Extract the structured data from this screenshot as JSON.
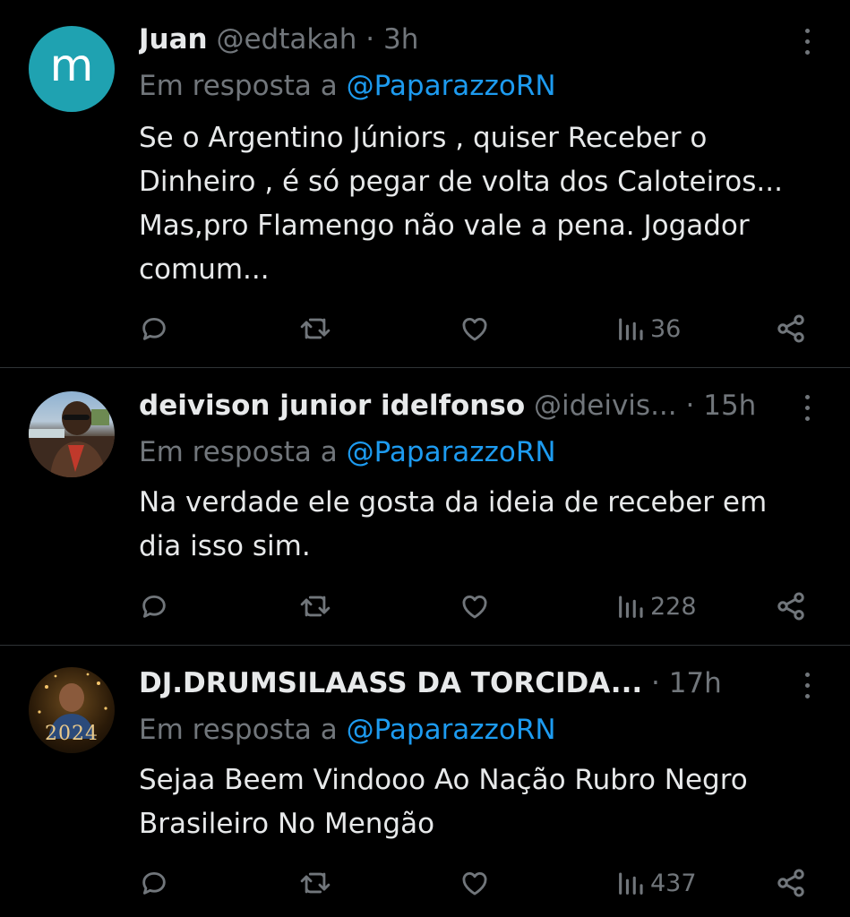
{
  "tweets": [
    {
      "avatar_letter": "m",
      "name": "Juan",
      "handle": "@edtakah",
      "time": "3h",
      "reply_prefix": "Em resposta a",
      "reply_to": "@PaparazzoRN",
      "lines": [
        "Se o Argentino Júniors , quiser Receber o",
        "Dinheiro , é só pegar de volta dos Caloteiros...",
        "Mas,pro Flamengo não vale a pena. Jogador",
        "comum..."
      ],
      "views": "36"
    },
    {
      "name": "deivison junior idelfonso",
      "handle": "@ideivis...",
      "time": "15h",
      "reply_prefix": "Em resposta a",
      "reply_to": "@PaparazzoRN",
      "lines": [
        "Na verdade ele gosta da ideia de receber em",
        "dia isso sim."
      ],
      "views": "228"
    },
    {
      "name": "DJ.DRUMSILAASS DA TORCIDA...",
      "time": "17h",
      "avatar_text": "2024",
      "reply_prefix": "Em resposta a",
      "reply_to": "@PaparazzoRN",
      "lines": [
        "Sejaa Beem Vindooo Ao Nação Rubro Negro",
        "Brasileiro No Mengão"
      ],
      "views": "437"
    }
  ],
  "separator": "·",
  "colors": {
    "background": "#000000",
    "text": "#e7e9ea",
    "muted": "#71767b",
    "link": "#1d9bf0",
    "avatar_m": "#1fa2b1"
  },
  "icons": [
    "reply-icon",
    "retweet-icon",
    "like-icon",
    "views-icon",
    "share-icon",
    "more-icon"
  ]
}
